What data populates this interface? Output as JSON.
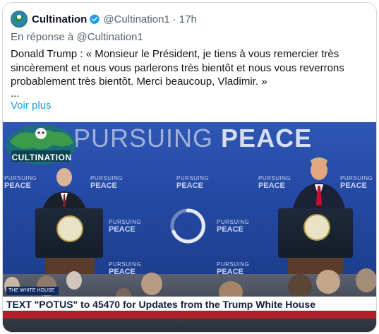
{
  "tweet": {
    "author_name": "Cultination",
    "handle": "@Cultination1",
    "separator": "·",
    "time": "17h",
    "reply_prefix": "En réponse à",
    "reply_to": "@Cultination1",
    "text": "Donald Trump : « Monsieur le Président, je tiens à vous remercier très sincèrement et nous vous parlerons très bientôt et nous vous reverrons probablement très bientôt. Merci beaucoup, Vladimir. »",
    "ellipsis": "...",
    "show_more": "Voir plus"
  },
  "video": {
    "banner_light": "PURSUING",
    "banner_bold": "PEACE",
    "tile_top": "PURSUING",
    "tile_bottom": "PEACE",
    "watermark": "CULTINATION",
    "lower_third_badge": "THE WHITE HOUSE",
    "ticker": "TEXT \"POTUS\" to 45470 for Updates from the Trump White House"
  },
  "colors": {
    "link": "#1d9bf0",
    "muted": "#536471",
    "verified": "#1d9bf0",
    "backdrop": "#2449a3",
    "ticker_red": "#b3202a"
  },
  "icons": {
    "verified": "verified-badge-icon",
    "loading": "loading-spinner-icon"
  }
}
